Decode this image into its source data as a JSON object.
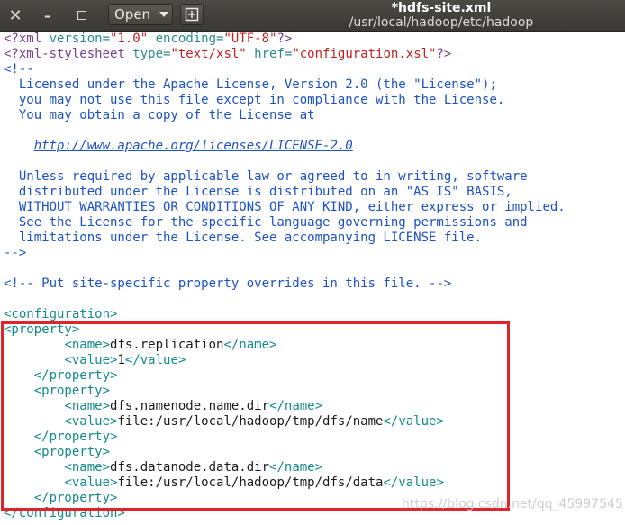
{
  "window": {
    "title": "*hdfs-site.xml",
    "path": "/usr/local/hadoop/etc/hadoop",
    "open_label": "Open"
  },
  "editor": {
    "xml_decl": {
      "open": "<?xml ",
      "version_attr": "version=",
      "version_val": "\"1.0\"",
      "encoding_attr": " encoding=",
      "encoding_val": "\"UTF-8\"",
      "close": "?>"
    },
    "stylesheet": {
      "open": "<?xml-stylesheet ",
      "type_attr": "type=",
      "type_val": "\"text/xsl\"",
      "href_attr": " href=",
      "href_val": "\"configuration.xsl\"",
      "close": "?>"
    },
    "comment_open": "<!--",
    "license": [
      "  Licensed under the Apache License, Version 2.0 (the \"License\");",
      "  you may not use this file except in compliance with the License.",
      "  You may obtain a copy of the License at"
    ],
    "license_link_indent": "    ",
    "license_link": "http://www.apache.org/licenses/LICENSE-2.0",
    "license2": [
      "  Unless required by applicable law or agreed to in writing, software",
      "  distributed under the License is distributed on an \"AS IS\" BASIS,",
      "  WITHOUT WARRANTIES OR CONDITIONS OF ANY KIND, either express or implied.",
      "  See the License for the specific language governing permissions and",
      "  limitations under the License. See accompanying LICENSE file."
    ],
    "comment_close": "-->",
    "site_comment": "<!-- Put site-specific property overrides in this file. -->",
    "configuration_open": "<configuration>",
    "property_open": "<property>",
    "property_close": "</property>",
    "name_open": "<name>",
    "name_close": "</name>",
    "value_open": "<value>",
    "value_close": "</value>",
    "configuration_close": "</configuration>",
    "properties": [
      {
        "name": "dfs.replication",
        "value": "1"
      },
      {
        "name": "dfs.namenode.name.dir",
        "value": "file:/usr/local/hadoop/tmp/dfs/name"
      },
      {
        "name": "dfs.datanode.data.dir",
        "value": "file:/usr/local/hadoop/tmp/dfs/data"
      }
    ]
  },
  "watermark": "https://blog.csdn.net/qq_45997545"
}
